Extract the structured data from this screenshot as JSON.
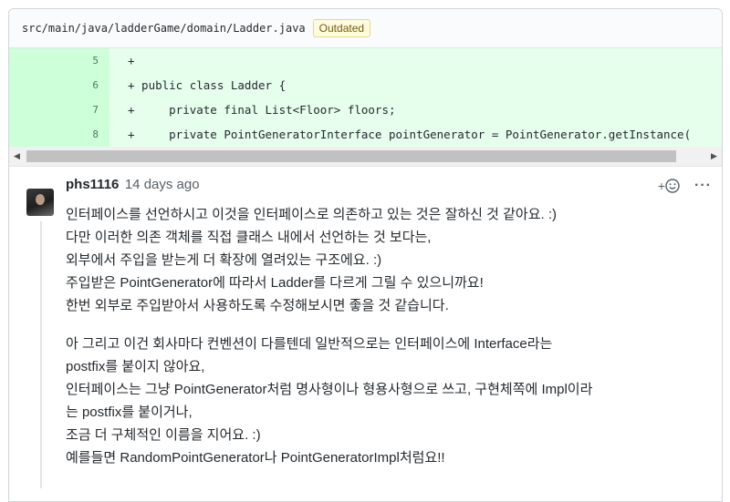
{
  "file": {
    "path": "src/main/java/ladderGame/domain/Ladder.java",
    "badge": "Outdated"
  },
  "diff": {
    "lines": [
      {
        "num": "5",
        "code": "+"
      },
      {
        "num": "6",
        "code": "+ public class Ladder {"
      },
      {
        "num": "7",
        "code": "+     private final List<Floor> floors;"
      },
      {
        "num": "8",
        "code": "+     private PointGeneratorInterface pointGenerator = PointGenerator.getInstance("
      }
    ]
  },
  "comment": {
    "author": "phs1116",
    "timestamp": "14 days ago",
    "emoji_label": "+",
    "more_label": "···",
    "paragraphs": [
      [
        "인터페이스를 선언하시고 이것을 인터페이스로 의존하고 있는 것은 잘하신 것 같아요. :)",
        "다만 이러한 의존 객체를 직접 클래스 내에서 선언하는 것 보다는,",
        "외부에서 주입을 받는게 더 확장에 열려있는 구조에요. :)",
        "주입받은 PointGenerator에 따라서 Ladder를 다르게 그릴 수 있으니까요!",
        "한번 외부로 주입받아서 사용하도록 수정해보시면 좋을 것 같습니다."
      ],
      [
        "아 그리고 이건 회사마다 컨벤션이 다를텐데 일반적으로는 인터페이스에 Interface라는",
        "postfix를 붙이지 않아요,",
        "인터페이스는 그냥 PointGenerator처럼 명사형이나 형용사형으로 쓰고, 구현체쪽에 Impl이라",
        "는 postfix를 붙이거나,",
        "조금 더 구체적인 이름을 지어요. :)",
        "예를들면 RandomPointGenerator나 PointGeneratorImpl처럼요!!"
      ]
    ]
  },
  "colors": {
    "added_bg": "#e6ffed",
    "added_gutter": "#cdffd8",
    "outdated_bg": "#fffbdd"
  }
}
